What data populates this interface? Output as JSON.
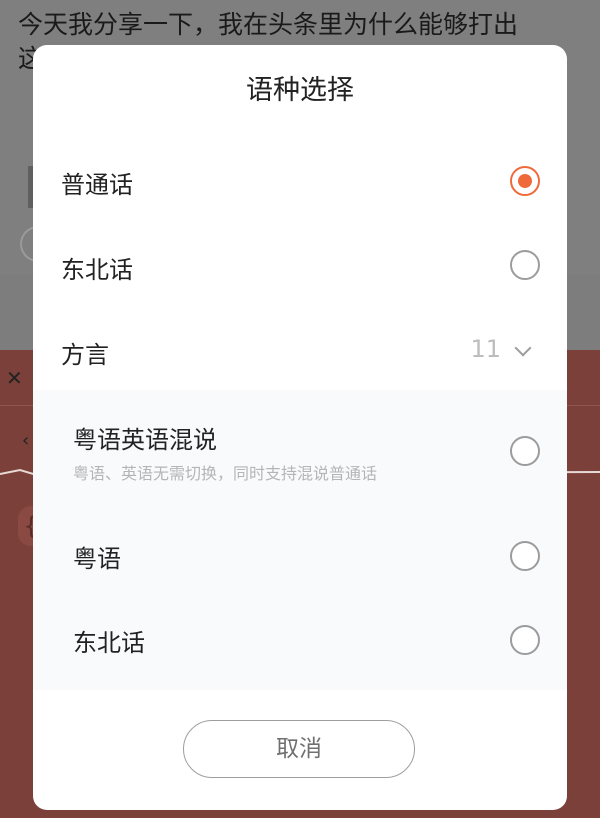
{
  "background": {
    "text_line_1": "今天我分享一下，我在头条里为什么能够打出",
    "text_line_2": "这"
  },
  "dialog": {
    "title": "语种选择",
    "options": [
      {
        "label": "普通话",
        "selected": true
      },
      {
        "label": "东北话",
        "selected": false
      }
    ],
    "dialect_group": {
      "label": "方言",
      "count": "11",
      "items": [
        {
          "label": "粤语英语混说",
          "description": "粤语、英语无需切换，同时支持混说普通话",
          "selected": false
        },
        {
          "label": "粤语",
          "selected": false
        },
        {
          "label": "东北话",
          "selected": false
        }
      ]
    },
    "cancel_label": "取消"
  },
  "colors": {
    "accent": "#ef6a3a",
    "overlay_gray": "#7f7f7f",
    "overlay_red": "#7b4039"
  }
}
